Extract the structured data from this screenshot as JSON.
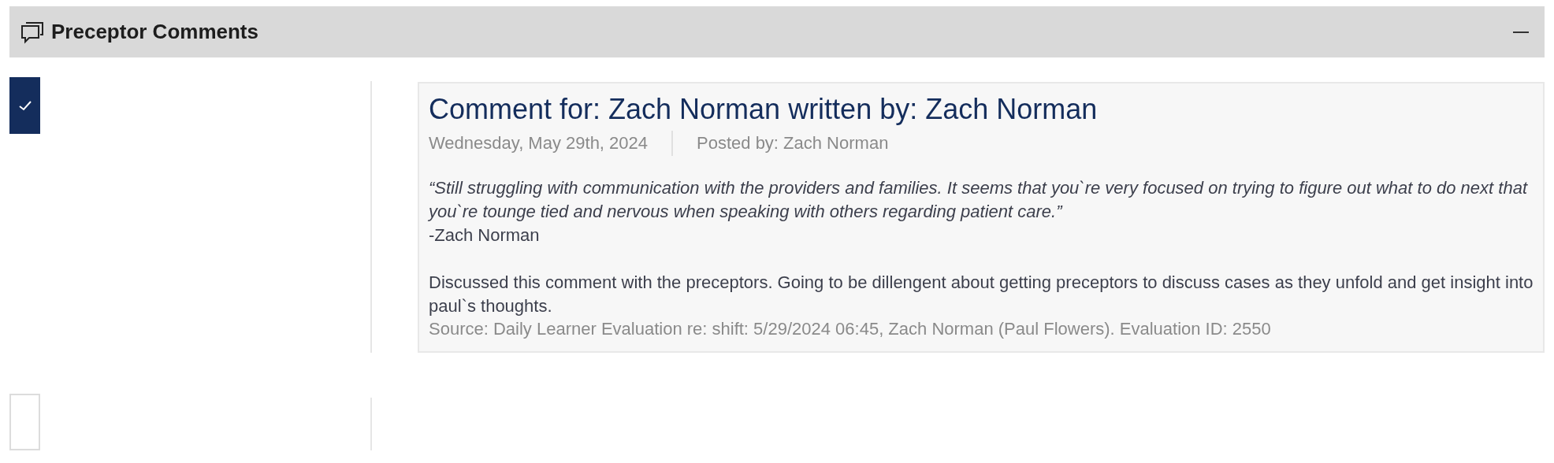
{
  "panel": {
    "title": "Preceptor Comments",
    "expanded": true
  },
  "entries": [
    {
      "checked": true,
      "comment": {
        "title": "Comment for: Zach Norman written by: Zach Norman",
        "date": "Wednesday, May 29th, 2024",
        "posted_by": "Posted by: Zach Norman",
        "quote": "“Still struggling with communication with the providers and families. It seems that you`re very focused on trying to figure out what to do next that you`re tounge tied and nervous when speaking with others regarding patient care.”",
        "author": "-Zach Norman",
        "note": "Discussed this comment with the preceptors. Going to be dillengent about getting preceptors to discuss cases as they unfold and get insight into paul`s thoughts.",
        "source": "Source: Daily Learner Evaluation re: shift: 5/29/2024 06:45, Zach Norman (Paul Flowers). Evaluation ID: 2550"
      }
    },
    {
      "checked": false
    }
  ]
}
